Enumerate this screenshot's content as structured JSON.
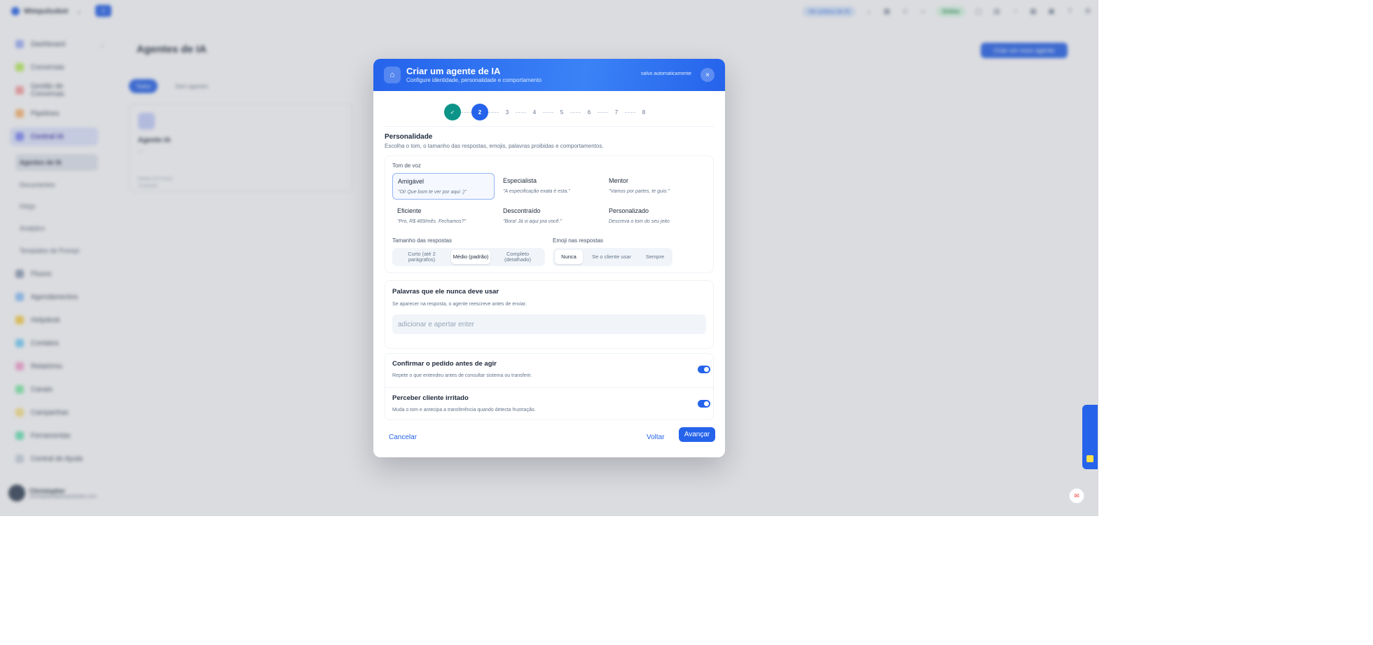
{
  "app": {
    "brand": "Wimpulsobot",
    "topbar_chip_plan": "Ver prática de IA",
    "topbar_status": "Online"
  },
  "sidebar": {
    "items": [
      {
        "label": "Dashboard"
      },
      {
        "label": "Conversas"
      },
      {
        "label": "Gestão de Conversas"
      },
      {
        "label": "Pipelines"
      },
      {
        "label": "Central IA"
      },
      {
        "label": "Fluxos"
      },
      {
        "label": "Agendamentos"
      },
      {
        "label": "Helpdesk"
      },
      {
        "label": "Contatos"
      },
      {
        "label": "Relatórios"
      },
      {
        "label": "Canais"
      },
      {
        "label": "Campanhas"
      },
      {
        "label": "Ferramentas"
      },
      {
        "label": "Central de Ajuda"
      }
    ],
    "sub_items": [
      {
        "label": "Agentes de IA"
      },
      {
        "label": "Documentos"
      },
      {
        "label": "FAQs"
      },
      {
        "label": "Analytics"
      },
      {
        "label": "Templates de Prompt"
      }
    ],
    "user": {
      "name": "Christopher",
      "email": "christopher@wimpulsobot.com"
    }
  },
  "main": {
    "page_title": "Agentes de IA",
    "create_button": "Criar um novo agente",
    "tab_all": "Todos",
    "tab_other": "Sem agentes",
    "card": {
      "name": "Agente IA",
      "desc": "—",
      "meta1": "Modelo de Prompt",
      "meta2": "Atualizado"
    }
  },
  "modal": {
    "title": "Criar um agente de IA",
    "subtitle": "Configure identidade, personalidade e comportamento",
    "saved": "salvo automaticamente",
    "close": "×",
    "steps": [
      "✓",
      "2",
      "3",
      "4",
      "5",
      "6",
      "7",
      "8"
    ],
    "current_step": 2,
    "section_title": "Personalidade",
    "section_subtitle": "Escolha o tom, o tamanho das respostas, emojis, palavras proibidas e comportamentos.",
    "tone": {
      "label": "Tom de voz",
      "options": [
        {
          "name": "Amigável",
          "quote": "\"Oi! Que bom te ver por aqui :)\""
        },
        {
          "name": "Especialista",
          "quote": "\"A especificação exata é esta.\""
        },
        {
          "name": "Mentor",
          "quote": "\"Vamos por partes, te guio.\""
        },
        {
          "name": "Eficiente",
          "quote": "\"Pro, R$ 489/mês. Fechamos?\""
        },
        {
          "name": "Descontraído",
          "quote": "\"Bora! Já vi aqui pra você.\""
        },
        {
          "name": "Personalizado",
          "quote": "Descreva o tom do seu jeito"
        }
      ],
      "selected": "Amigável"
    },
    "length": {
      "label": "Tamanho das respostas",
      "options": [
        "Curto (até 2 parágrafos)",
        "Médio (padrão)",
        "Completo (detalhado)"
      ],
      "selected": "Médio (padrão)"
    },
    "emoji": {
      "label": "Emoji nas respostas",
      "options": [
        "Nunca",
        "Se o cliente usar",
        "Sempre"
      ],
      "selected": "Nunca"
    },
    "forbidden": {
      "title": "Palavras que ele nunca deve usar",
      "subtitle": "Se aparecer na resposta, o agente reescreve antes de enviar.",
      "placeholder": "adicionar e apertar enter",
      "value": ""
    },
    "toggles": [
      {
        "title": "Confirmar o pedido antes de agir",
        "subtitle": "Repete o que entendeu antes de consultar sistema ou transferir.",
        "on": true
      },
      {
        "title": "Perceber cliente irritado",
        "subtitle": "Muda o tom e antecipa a transferência quando detecta frustração.",
        "on": true
      }
    ],
    "footer": {
      "cancel": "Cancelar",
      "back": "Voltar",
      "next": "Avançar"
    }
  },
  "colors": {
    "accent": "#2563eb",
    "done": "#0d9488",
    "header_gradient_start": "#2563eb",
    "header_gradient_end": "#3b82f6"
  }
}
